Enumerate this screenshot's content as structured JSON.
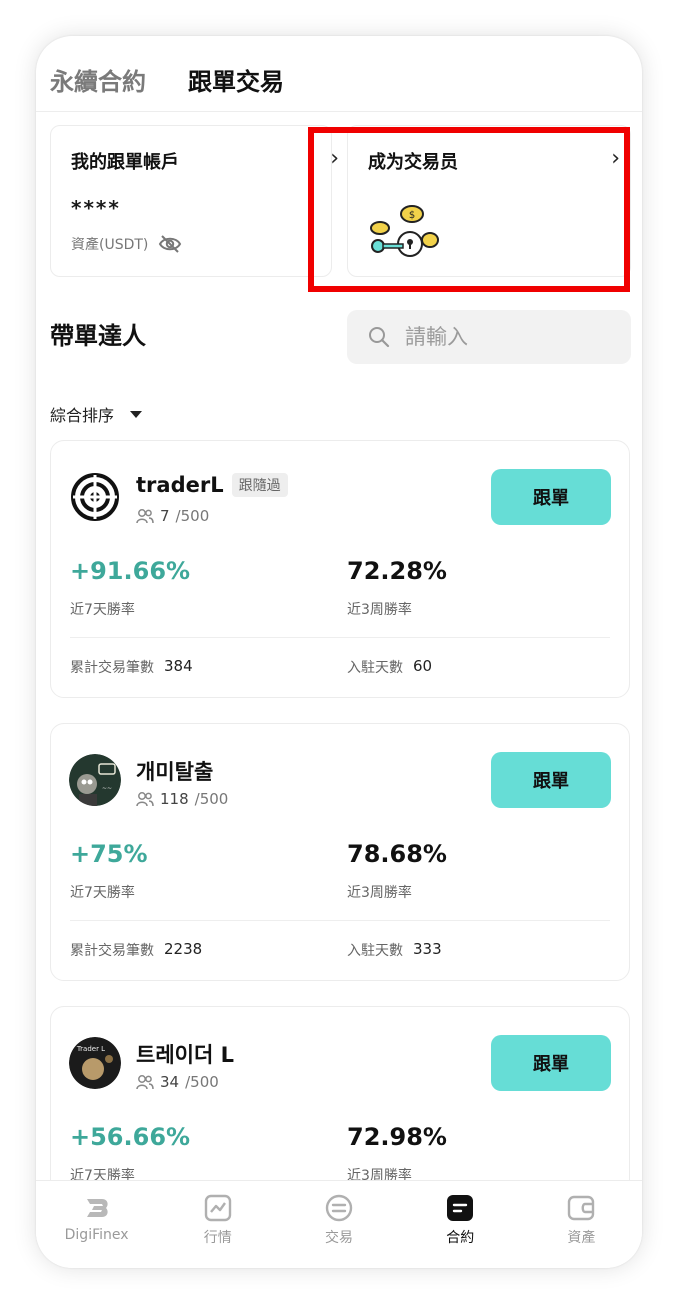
{
  "top_tabs": [
    "永續合約",
    "跟單交易"
  ],
  "my_account": {
    "title": "我的跟單帳戶",
    "masked_value": "****",
    "asset_label": "資產(USDT)"
  },
  "become_trader": {
    "title": "成为交易员"
  },
  "section": {
    "title": "帶單達人",
    "search_placeholder": "請輸入",
    "sort_label": "綜合排序"
  },
  "traders": [
    {
      "name": "traderL",
      "badge": "跟隨過",
      "followers": "7",
      "capacity": "/500",
      "roi": "+91.66%",
      "roi_label": "近7天勝率",
      "win_rate": "72.28%",
      "win_rate_label": "近3周勝率",
      "trades_label": "累計交易筆數",
      "trades": "384",
      "days_label": "入駐天數",
      "days": "60",
      "button": "跟單"
    },
    {
      "name": "개미탈출",
      "badge": "",
      "followers": "118",
      "capacity": "/500",
      "roi": "+75%",
      "roi_label": "近7天勝率",
      "win_rate": "78.68%",
      "win_rate_label": "近3周勝率",
      "trades_label": "累計交易筆數",
      "trades": "2238",
      "days_label": "入駐天數",
      "days": "333",
      "button": "跟單"
    },
    {
      "name": "트레이더 L",
      "badge": "",
      "followers": "34",
      "capacity": "/500",
      "roi": "+56.66%",
      "roi_label": "近7天勝率",
      "win_rate": "72.98%",
      "win_rate_label": "近3周勝率",
      "trades_label": "",
      "trades": "",
      "days_label": "",
      "days": "",
      "button": "跟單"
    }
  ],
  "bottom_nav": [
    {
      "label": "DigiFinex",
      "icon": "digifinex-logo-icon"
    },
    {
      "label": "行情",
      "icon": "market-chart-icon"
    },
    {
      "label": "交易",
      "icon": "exchange-icon"
    },
    {
      "label": "合約",
      "icon": "contract-icon"
    },
    {
      "label": "資產",
      "icon": "wallet-icon"
    }
  ],
  "colors": {
    "accent": "#66ddd6",
    "positive": "#3ea89a",
    "highlight": "#f00000"
  }
}
